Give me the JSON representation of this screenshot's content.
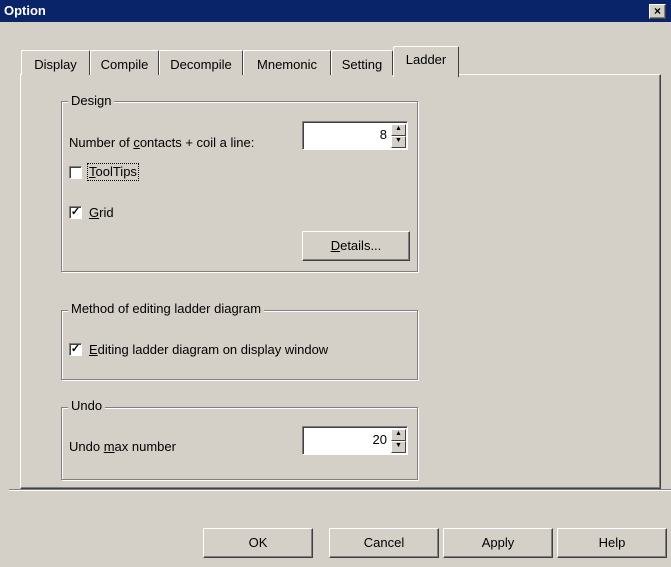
{
  "window": {
    "title": "Option",
    "close_glyph": "×"
  },
  "tabs": [
    {
      "label": "Display"
    },
    {
      "label": "Compile"
    },
    {
      "label": "Decompile"
    },
    {
      "label": "Mnemonic"
    },
    {
      "label": "Setting"
    },
    {
      "label": "Ladder",
      "active": true
    }
  ],
  "design": {
    "legend": "Design",
    "contacts_label_pre": "Number of ",
    "contacts_label_accel": "c",
    "contacts_label_post": "ontacts + coil a line:",
    "contacts_value": "8",
    "tooltips_accel": "T",
    "tooltips_rest": "oolTips",
    "tooltips_checked": false,
    "grid_accel": "G",
    "grid_rest": "rid",
    "grid_checked": true,
    "details_accel": "D",
    "details_rest": "etails..."
  },
  "method": {
    "legend": "Method of editing ladder diagram",
    "editing_accel": "E",
    "editing_rest": "diting ladder diagram on display window",
    "editing_checked": true
  },
  "undo": {
    "legend": "Undo",
    "label_pre": "Undo ",
    "label_accel": "m",
    "label_post": "ax number",
    "value": "20"
  },
  "buttons": {
    "ok": "OK",
    "cancel": "Cancel",
    "apply": "Apply",
    "help": "Help"
  },
  "glyphs": {
    "check": "✓",
    "spin_up": "▲",
    "spin_down": "▼"
  }
}
